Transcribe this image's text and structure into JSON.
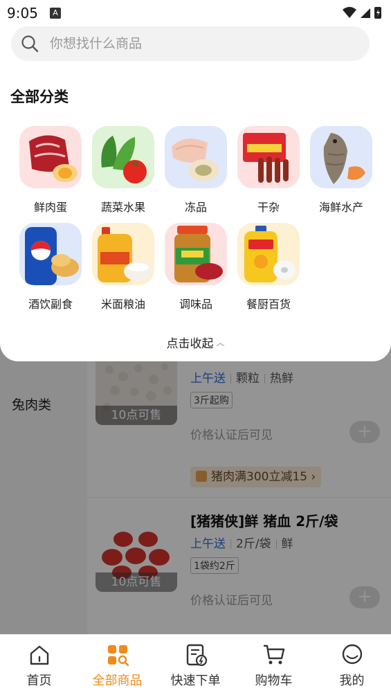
{
  "status_bar": {
    "time": "9:05",
    "notif_letter": "A"
  },
  "search": {
    "placeholder": "你想找什么商品"
  },
  "section_title": "全部分类",
  "categories": [
    {
      "label": "鲜肉蛋",
      "icon": "meat-egg-icon"
    },
    {
      "label": "蔬菜水果",
      "icon": "vegetable-fruit-icon"
    },
    {
      "label": "冻品",
      "icon": "frozen-food-icon"
    },
    {
      "label": "干杂",
      "icon": "sausage-icon"
    },
    {
      "label": "海鲜水产",
      "icon": "fish-seafood-icon"
    },
    {
      "label": "酒饮副食",
      "icon": "drink-snack-icon"
    },
    {
      "label": "米面粮油",
      "icon": "rice-oil-icon"
    },
    {
      "label": "调味品",
      "icon": "seasoning-jar-icon"
    },
    {
      "label": "餐厨百货",
      "icon": "detergent-icon"
    }
  ],
  "collapse_label": "点击收起",
  "left_category": "兔肉类",
  "products": [
    {
      "delivery": "上午送",
      "tags": [
        "颗粒",
        "热鲜"
      ],
      "min_order": "3斤起购",
      "price_text": "价格认证后可见",
      "sale_time": "10点可售",
      "promo": "猪肉满300立减15",
      "promo_arrow": "›"
    },
    {
      "title": "[猪猪侠]鲜 猪血 2斤/袋",
      "delivery": "上午送",
      "tags": [
        "2斤/袋",
        "鲜"
      ],
      "min_order": "1袋约2斤",
      "price_text": "价格认证后可见",
      "sale_time": "10点可售"
    }
  ],
  "bottom_nav": [
    {
      "label": "首页",
      "icon": "home-icon",
      "active": false
    },
    {
      "label": "全部商品",
      "icon": "all-products-icon",
      "active": true
    },
    {
      "label": "快速下单",
      "icon": "quick-order-icon",
      "active": false
    },
    {
      "label": "购物车",
      "icon": "cart-icon",
      "active": false
    },
    {
      "label": "我的",
      "icon": "profile-icon",
      "active": false
    }
  ],
  "colors": {
    "accent": "#f08a1c",
    "delivery_blue": "#2f6bd8"
  }
}
